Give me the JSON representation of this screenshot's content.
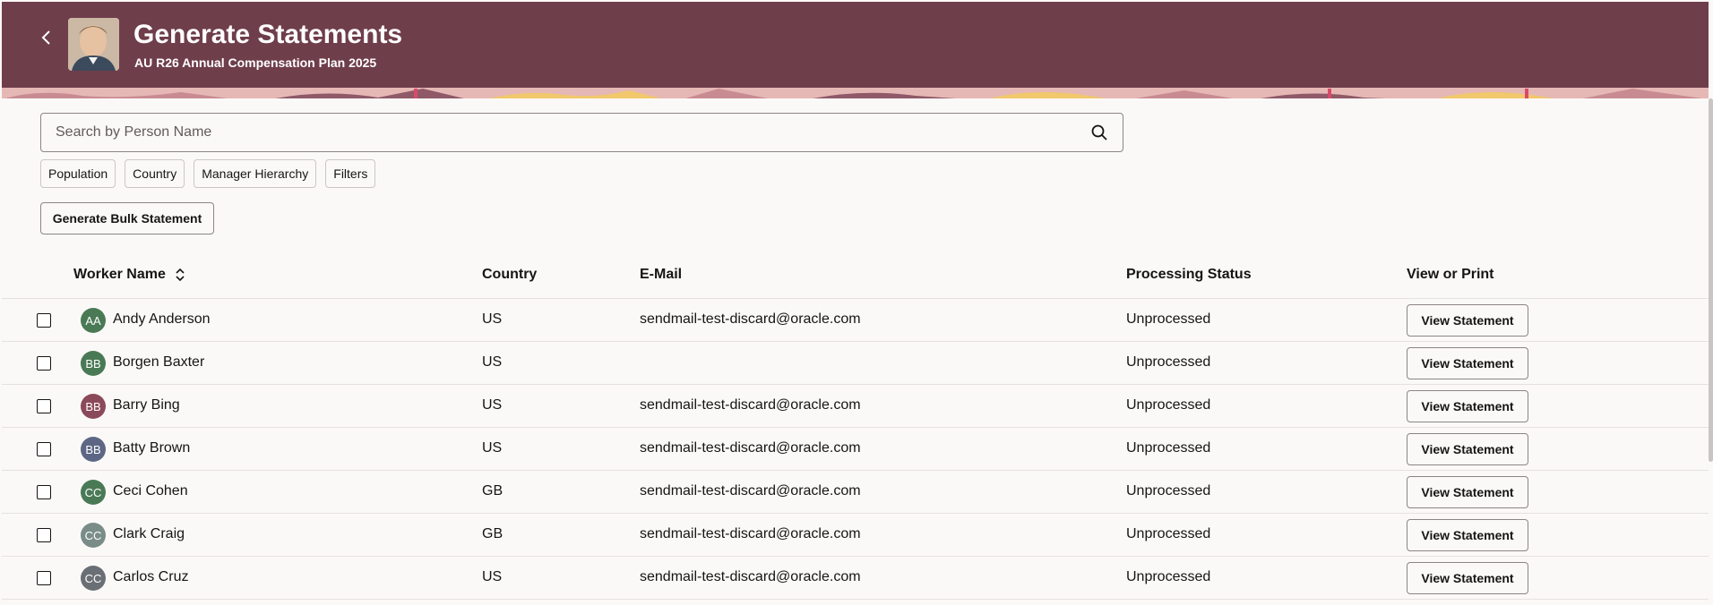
{
  "header": {
    "title": "Generate Statements",
    "subtitle": "AU R26 Annual Compensation Plan 2025",
    "bg_color": "#6f3e4b"
  },
  "search": {
    "placeholder": "Search by Person Name",
    "icon": "search-icon"
  },
  "filters": [
    "Population",
    "Country",
    "Manager Hierarchy",
    "Filters"
  ],
  "actions": {
    "bulk_label": "Generate Bulk Statement"
  },
  "table": {
    "columns": {
      "worker_name": "Worker Name",
      "country": "Country",
      "email": "E-Mail",
      "status": "Processing Status",
      "view": "View or Print"
    },
    "rows": [
      {
        "initials": "AA",
        "name": "Andy Anderson",
        "country": "US",
        "email": "sendmail-test-discard@oracle.com",
        "status": "Unprocessed",
        "button": "View Statement",
        "avatar_color": "#4a7a55"
      },
      {
        "initials": "BB",
        "name": "Borgen Baxter",
        "country": "US",
        "email": "",
        "status": "Unprocessed",
        "button": "View Statement",
        "avatar_color": "#4a7a55"
      },
      {
        "initials": "BB",
        "name": "Barry Bing",
        "country": "US",
        "email": "sendmail-test-discard@oracle.com",
        "status": "Unprocessed",
        "button": "View Statement",
        "avatar_color": "#8b4a5a"
      },
      {
        "initials": "BB",
        "name": "Batty Brown",
        "country": "US",
        "email": "sendmail-test-discard@oracle.com",
        "status": "Unprocessed",
        "button": "View Statement",
        "avatar_color": "#5d6785"
      },
      {
        "initials": "CC",
        "name": "Ceci Cohen",
        "country": "GB",
        "email": "sendmail-test-discard@oracle.com",
        "status": "Unprocessed",
        "button": "View Statement",
        "avatar_color": "#4a7a55"
      },
      {
        "initials": "CC",
        "name": "Clark Craig",
        "country": "GB",
        "email": "sendmail-test-discard@oracle.com",
        "status": "Unprocessed",
        "button": "View Statement",
        "avatar_color": "#7a8c88"
      },
      {
        "initials": "CC",
        "name": "Carlos Cruz",
        "country": "US",
        "email": "sendmail-test-discard@oracle.com",
        "status": "Unprocessed",
        "button": "View Statement",
        "avatar_color": "#6a6e75"
      }
    ]
  }
}
